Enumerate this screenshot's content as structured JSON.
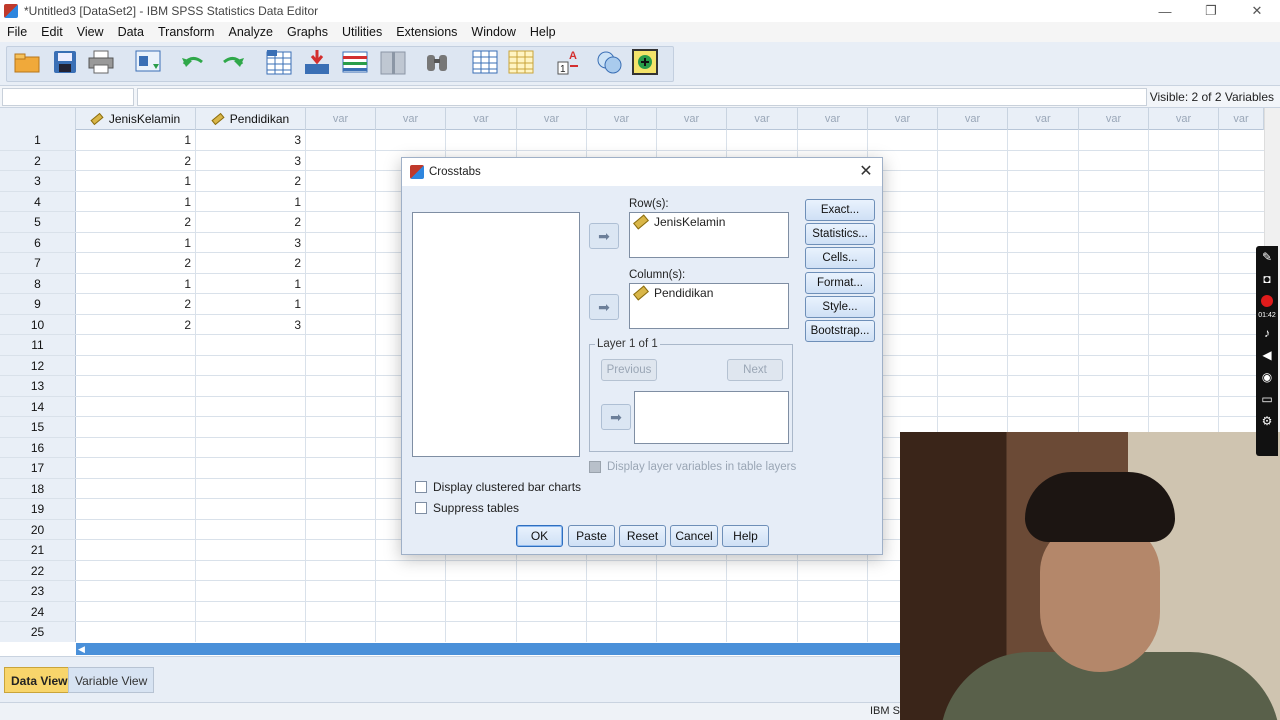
{
  "window": {
    "title": "*Untitled3 [DataSet2] - IBM SPSS Statistics Data Editor",
    "controls": [
      "—",
      "❐",
      "✕"
    ]
  },
  "menu": [
    "File",
    "Edit",
    "View",
    "Data",
    "Transform",
    "Analyze",
    "Graphs",
    "Utilities",
    "Extensions",
    "Window",
    "Help"
  ],
  "toolbar": {
    "icons": [
      "open-folder-icon",
      "save-icon",
      "print-icon",
      "recall-dialog-icon",
      "undo-icon",
      "redo-icon",
      "goto-case-icon",
      "goto-variable-icon",
      "variables-icon",
      "split-file-icon",
      "find-icon",
      "insert-cases-icon",
      "insert-variable-icon",
      "value-labels-icon",
      "use-sets-icon",
      "spell-check-icon"
    ]
  },
  "editor": {
    "visible_label": "Visible: 2 of 2 Variables"
  },
  "grid": {
    "columns": [
      "JenisKelamin",
      "Pendidikan",
      "var",
      "var",
      "var",
      "var",
      "var",
      "var",
      "var",
      "var",
      "var",
      "var",
      "var",
      "var",
      "var",
      "var",
      "var"
    ],
    "row_numbers": [
      "1",
      "2",
      "3",
      "4",
      "5",
      "6",
      "7",
      "8",
      "9",
      "10",
      "11",
      "12",
      "13",
      "14",
      "15",
      "16",
      "17",
      "18",
      "19",
      "20",
      "21",
      "22",
      "23",
      "24",
      "25"
    ],
    "data": [
      [
        "1",
        "3"
      ],
      [
        "2",
        "3"
      ],
      [
        "1",
        "2"
      ],
      [
        "1",
        "1"
      ],
      [
        "2",
        "2"
      ],
      [
        "1",
        "3"
      ],
      [
        "2",
        "2"
      ],
      [
        "1",
        "1"
      ],
      [
        "2",
        "1"
      ],
      [
        "2",
        "3"
      ]
    ]
  },
  "tabs": {
    "data_view": "Data View",
    "variable_view": "Variable View"
  },
  "status": {
    "text": "IBM S"
  },
  "dialog": {
    "title": "Crosstabs",
    "rows_label": "Row(s):",
    "rows_items": [
      "JenisKelamin"
    ],
    "columns_label": "Column(s):",
    "columns_items": [
      "Pendidikan"
    ],
    "layer_label": "Layer 1 of 1",
    "previous": "Previous",
    "next": "Next",
    "display_layer": "Display layer variables in table layers",
    "side_buttons": [
      "Exact...",
      "Statistics...",
      "Cells...",
      "Format...",
      "Style...",
      "Bootstrap..."
    ],
    "clustered": "Display clustered bar charts",
    "suppress": "Suppress tables",
    "buttons": {
      "ok": "OK",
      "paste": "Paste",
      "reset": "Reset",
      "cancel": "Cancel",
      "help": "Help"
    }
  },
  "recorder": {
    "time": "01:42"
  }
}
